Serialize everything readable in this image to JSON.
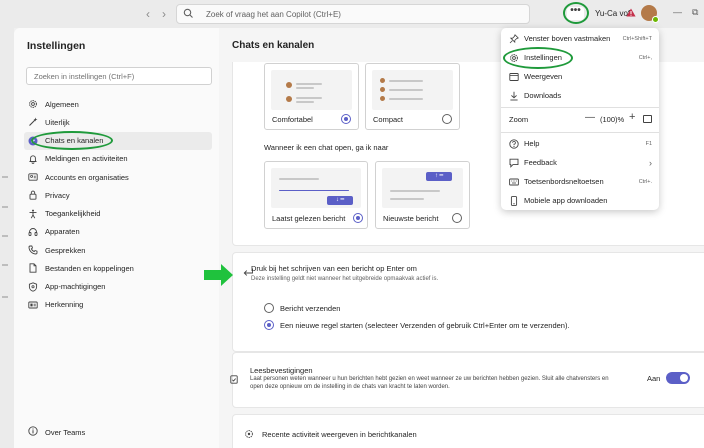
{
  "titlebar": {
    "search_placeholder": "Zoek of vraag het aan Copilot (Ctrl+E)",
    "more_label": "•••",
    "org_label": "Yu-Ca vof",
    "back_glyph": "‹",
    "forward_glyph": "›",
    "minimize_glyph": "—",
    "restore_glyph": "⧉"
  },
  "sidebar": {
    "title": "Instellingen",
    "search_placeholder": "Zoeken in instellingen (Ctrl+F)",
    "items": [
      {
        "label": "Algemeen",
        "icon": "gear-icon"
      },
      {
        "label": "Uiterlijk",
        "icon": "wand-icon"
      },
      {
        "label": "Chats en kanalen",
        "icon": "chat-icon",
        "active": true
      },
      {
        "label": "Meldingen en activiteiten",
        "icon": "bell-icon"
      },
      {
        "label": "Accounts en organisaties",
        "icon": "account-icon"
      },
      {
        "label": "Privacy",
        "icon": "lock-icon"
      },
      {
        "label": "Toegankelijkheid",
        "icon": "accessibility-icon"
      },
      {
        "label": "Apparaten",
        "icon": "headset-icon"
      },
      {
        "label": "Gesprekken",
        "icon": "phone-icon"
      },
      {
        "label": "Bestanden en koppelingen",
        "icon": "file-icon"
      },
      {
        "label": "App-machtigingen",
        "icon": "shield-icon"
      },
      {
        "label": "Herkenning",
        "icon": "badge-icon"
      }
    ],
    "about_label": "Over Teams"
  },
  "main": {
    "title": "Chats en kanalen",
    "density": {
      "options": [
        {
          "label": "Comfortabel",
          "selected": true
        },
        {
          "label": "Compact",
          "selected": false
        }
      ]
    },
    "open_chat": {
      "question": "Wanneer ik een chat open, ga ik naar",
      "options": [
        {
          "label": "Laatst gelezen bericht",
          "selected": true
        },
        {
          "label": "Nieuwste bericht",
          "selected": false
        }
      ]
    },
    "enter": {
      "title": "Druk bij het schrijven van een bericht op Enter om",
      "subtitle": "Deze instelling geldt niet wanneer het uitgebreide opmaakvak actief is.",
      "options": [
        {
          "label": "Bericht verzenden",
          "selected": false
        },
        {
          "label": "Een nieuwe regel starten (selecteer Verzenden of gebruik Ctrl+Enter om te verzenden).",
          "selected": true
        }
      ]
    },
    "read_receipts": {
      "title": "Leesbevestigingen",
      "description": "Laat personen weten wanneer u hun berichten hebt gezien en weet wanneer ze uw berichten hebben gezien. Sluit alle chatvensters en open deze opnieuw om de instelling in de chats van kracht te laten worden.",
      "toggle_label": "Aan",
      "toggle_on": true
    },
    "recent_activity": {
      "title": "Recente activiteit weergeven in berichtkanalen"
    }
  },
  "menu": {
    "items": [
      {
        "label": "Venster boven vastmaken",
        "shortcut": "Ctrl+Shift+T",
        "icon": "pin-icon"
      },
      {
        "label": "Instellingen",
        "shortcut": "Ctrl+,",
        "icon": "gear-icon"
      },
      {
        "label": "Weergeven",
        "shortcut": "",
        "icon": "view-icon"
      },
      {
        "label": "Downloads",
        "shortcut": "",
        "icon": "download-icon"
      }
    ],
    "zoom": {
      "label": "Zoom",
      "value": "(100)%",
      "minus": "—",
      "plus": "+"
    },
    "items2": [
      {
        "label": "Help",
        "shortcut": "F1",
        "icon": "help-icon"
      },
      {
        "label": "Feedback",
        "shortcut": "›",
        "icon": "feedback-icon"
      },
      {
        "label": "Toetsenbordsneltoetsen",
        "shortcut": "Ctrl+.",
        "icon": "keyboard-icon"
      },
      {
        "label": "Mobiele app downloaden",
        "shortcut": "",
        "icon": "mobile-icon"
      }
    ]
  },
  "colors": {
    "accent": "#5b5fc7",
    "highlight_ring": "#1f9a3b",
    "arrow": "#1fc23d"
  }
}
